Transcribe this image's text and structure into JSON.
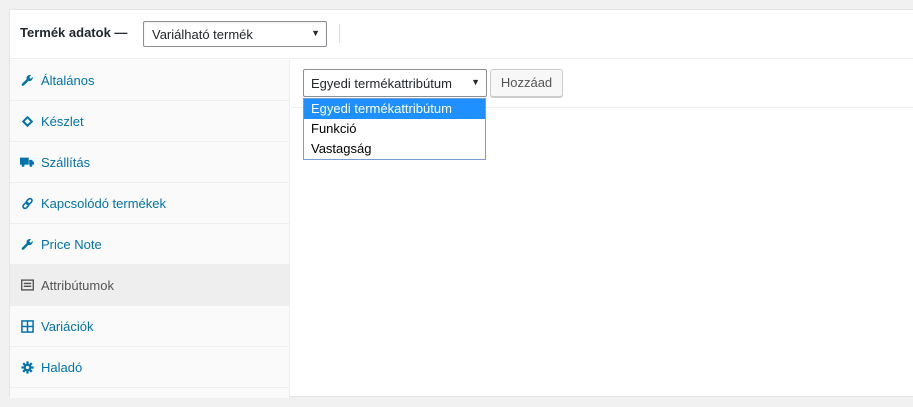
{
  "header": {
    "title": "Termék adatok —",
    "product_type": "Variálható termék"
  },
  "sidebar": {
    "items": [
      {
        "label": "Általános",
        "icon": "wrench-icon",
        "active": false
      },
      {
        "label": "Készlet",
        "icon": "tag-icon",
        "active": false
      },
      {
        "label": "Szállítás",
        "icon": "truck-icon",
        "active": false
      },
      {
        "label": "Kapcsolódó termékek",
        "icon": "link-icon",
        "active": false
      },
      {
        "label": "Price Note",
        "icon": "wrench-icon",
        "active": false
      },
      {
        "label": "Attribútumok",
        "icon": "list-icon",
        "active": true
      },
      {
        "label": "Variációk",
        "icon": "grid-icon",
        "active": false
      },
      {
        "label": "Haladó",
        "icon": "gear-icon",
        "active": false
      }
    ]
  },
  "attributes": {
    "selected": "Egyedi termékattribútum",
    "add_label": "Hozzáad",
    "options": [
      "Egyedi termékattribútum",
      "Funkció",
      "Vastagság"
    ]
  },
  "colors": {
    "link": "#0073aa",
    "highlight": "#1e90ff",
    "active_bg": "#eeeeee"
  }
}
